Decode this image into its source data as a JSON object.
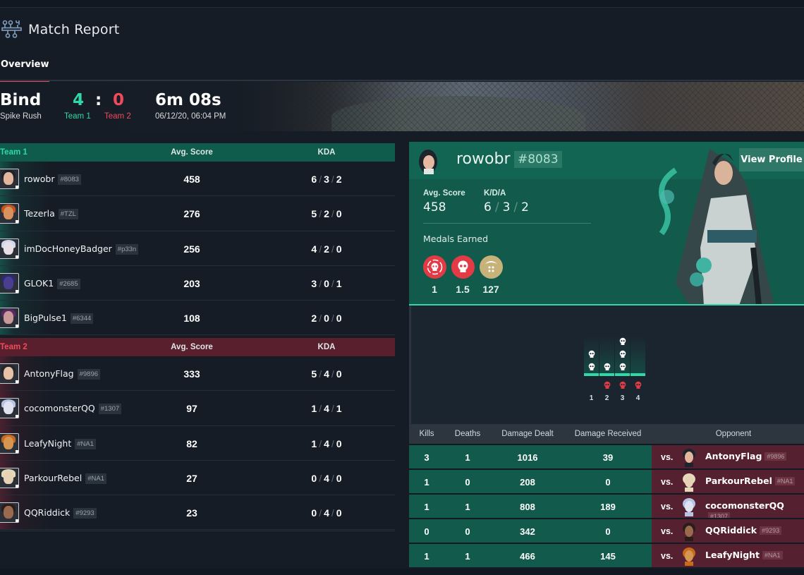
{
  "header": {
    "title": "Match Report",
    "icon": "network-hub-icon"
  },
  "tabs": [
    {
      "label": "Overview",
      "active": true
    }
  ],
  "match": {
    "map": "Bind",
    "mode": "Spike Rush",
    "team1_score": "4",
    "separator": ":",
    "team2_score": "0",
    "team1_label": "Team 1",
    "team2_label": "Team 2",
    "duration": "6m 08s",
    "datetime": "06/12/20, 06:04 PM"
  },
  "colors": {
    "team1": "#2fd8a6",
    "team2": "#f04a5b",
    "team1_bg": "#125a4b",
    "team2_bg": "#55202f",
    "tab_accent": "#e84a5f",
    "medal_red": "#e23b46",
    "medal_gold": "#c7b27a"
  },
  "columns": {
    "avg_score": "Avg. Score",
    "kda": "KDA"
  },
  "team1": {
    "name": "Team 1",
    "players": [
      {
        "name": "rowobr",
        "tag": "#8083",
        "score": "458",
        "k": "6",
        "d": "3",
        "a": "2"
      },
      {
        "name": "Tezerla",
        "tag": "#TZL",
        "score": "276",
        "k": "5",
        "d": "2",
        "a": "0"
      },
      {
        "name": "imDocHoneyBadger",
        "tag": "#p33n",
        "score": "256",
        "k": "4",
        "d": "2",
        "a": "0"
      },
      {
        "name": "GLOK1",
        "tag": "#2685",
        "score": "203",
        "k": "3",
        "d": "0",
        "a": "1"
      },
      {
        "name": "BigPulse1",
        "tag": "#6344",
        "score": "108",
        "k": "2",
        "d": "0",
        "a": "0"
      }
    ]
  },
  "team2": {
    "name": "Team 2",
    "players": [
      {
        "name": "AntonyFlag",
        "tag": "#9896",
        "score": "333",
        "k": "5",
        "d": "4",
        "a": "0"
      },
      {
        "name": "cocomonsterQQ",
        "tag": "#1307",
        "score": "97",
        "k": "1",
        "d": "4",
        "a": "1"
      },
      {
        "name": "LeafyNight",
        "tag": "#NA1",
        "score": "82",
        "k": "1",
        "d": "4",
        "a": "0"
      },
      {
        "name": "ParkourRebel",
        "tag": "#NA1",
        "score": "27",
        "k": "0",
        "d": "4",
        "a": "0"
      },
      {
        "name": "QQRiddick",
        "tag": "#9293",
        "score": "23",
        "k": "0",
        "d": "4",
        "a": "0"
      }
    ]
  },
  "profile": {
    "name": "rowobr",
    "tag": "#8083",
    "view_profile_label": "View Profile",
    "avg_score_label": "Avg. Score",
    "avg_score": "458",
    "kda_label": "K/D/A",
    "k": "6",
    "d": "3",
    "a": "2",
    "medals_title": "Medals Earned",
    "medals": [
      {
        "icon": "first-blood-skull-icon",
        "value": "1"
      },
      {
        "icon": "skull-icon",
        "value": "1.5"
      },
      {
        "icon": "gold-crest-icon",
        "value": "127"
      }
    ]
  },
  "rounds": [
    {
      "number": "1",
      "kills": 2,
      "deaths": 0
    },
    {
      "number": "2",
      "kills": 1,
      "deaths": 1
    },
    {
      "number": "3",
      "kills": 3,
      "deaths": 1
    },
    {
      "number": "4",
      "kills": 0,
      "deaths": 1
    }
  ],
  "duels": {
    "headers": {
      "kills": "Kills",
      "deaths": "Deaths",
      "damage_dealt": "Damage Dealt",
      "damage_received": "Damage Received",
      "opponent": "Opponent"
    },
    "vs_label": "vs.",
    "rows": [
      {
        "kills": "3",
        "deaths": "1",
        "dealt": "1016",
        "received": "39",
        "opponent": "AntonyFlag",
        "tag": "#9896"
      },
      {
        "kills": "1",
        "deaths": "0",
        "dealt": "208",
        "received": "0",
        "opponent": "ParkourRebel",
        "tag": "#NA1"
      },
      {
        "kills": "1",
        "deaths": "1",
        "dealt": "808",
        "received": "189",
        "opponent": "cocomonsterQQ",
        "tag": "#1307"
      },
      {
        "kills": "0",
        "deaths": "0",
        "dealt": "342",
        "received": "0",
        "opponent": "QQRiddick",
        "tag": "#9293"
      },
      {
        "kills": "1",
        "deaths": "1",
        "dealt": "466",
        "received": "145",
        "opponent": "LeafyNight",
        "tag": "#NA1"
      }
    ]
  }
}
